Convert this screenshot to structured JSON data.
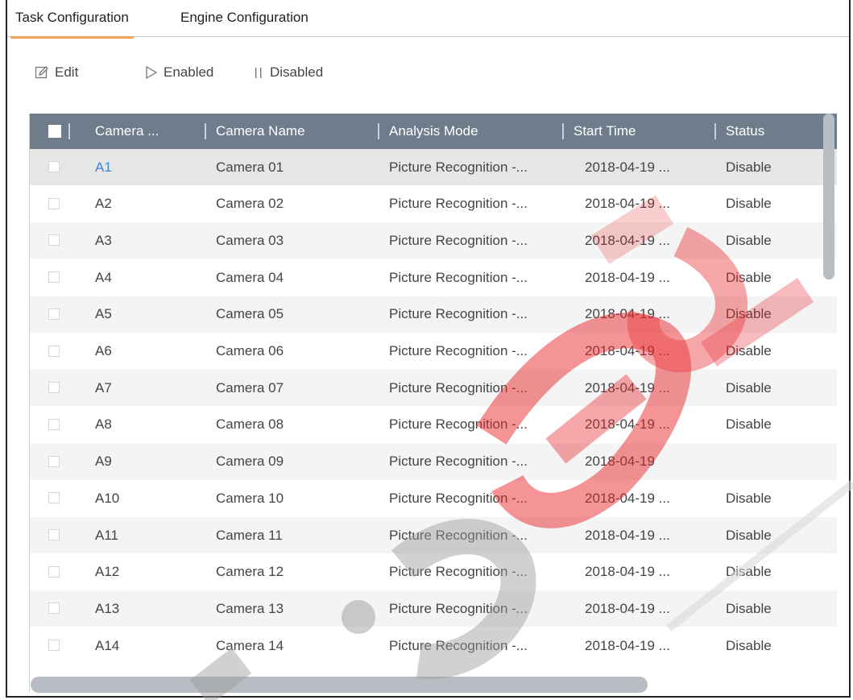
{
  "tabs": [
    {
      "label": "Task Configuration",
      "active": true
    },
    {
      "label": "Engine Configuration",
      "active": false
    }
  ],
  "toolbar": {
    "edit": "Edit",
    "enabled": "Enabled",
    "disabled": "Disabled"
  },
  "table": {
    "columns": [
      "Camera ...",
      "Camera Name",
      "Analysis Mode",
      "Start Time",
      "Status"
    ],
    "rows": [
      {
        "id": "A1",
        "name": "Camera 01",
        "mode": "Picture Recognition -...",
        "start": "2018-04-19 ...",
        "status": "Disable"
      },
      {
        "id": "A2",
        "name": "Camera 02",
        "mode": "Picture Recognition -...",
        "start": "2018-04-19 ...",
        "status": "Disable"
      },
      {
        "id": "A3",
        "name": "Camera 03",
        "mode": "Picture Recognition -...",
        "start": "2018-04-19 ...",
        "status": "Disable"
      },
      {
        "id": "A4",
        "name": "Camera 04",
        "mode": "Picture Recognition -...",
        "start": "2018-04-19 ...",
        "status": "Disable"
      },
      {
        "id": "A5",
        "name": "Camera 05",
        "mode": "Picture Recognition -...",
        "start": "2018-04-19 ...",
        "status": "Disable"
      },
      {
        "id": "A6",
        "name": "Camera 06",
        "mode": "Picture Recognition -...",
        "start": "2018-04-19 ...",
        "status": "Disable"
      },
      {
        "id": "A7",
        "name": "Camera 07",
        "mode": "Picture Recognition -...",
        "start": "2018-04-19 ...",
        "status": "Disable"
      },
      {
        "id": "A8",
        "name": "Camera 08",
        "mode": "Picture Recognition -...",
        "start": "2018-04-19 ...",
        "status": "Disable"
      },
      {
        "id": "A9",
        "name": "Camera 09",
        "mode": "Picture Recognition -...",
        "start": "2018-04-19",
        "status": ""
      },
      {
        "id": "A10",
        "name": "Camera 10",
        "mode": "Picture Recognition -...",
        "start": "2018-04-19 ...",
        "status": "Disable"
      },
      {
        "id": "A11",
        "name": "Camera 11",
        "mode": "Picture Recognition -...",
        "start": "2018-04-19 ...",
        "status": "Disable"
      },
      {
        "id": "A12",
        "name": "Camera 12",
        "mode": "Picture Recognition -...",
        "start": "2018-04-19 ...",
        "status": "Disable"
      },
      {
        "id": "A13",
        "name": "Camera 13",
        "mode": "Picture Recognition -...",
        "start": "2018-04-19 ...",
        "status": "Disable"
      },
      {
        "id": "A14",
        "name": "Camera 14",
        "mode": "Picture Recognition -...",
        "start": "2018-04-19 ...",
        "status": "Disable"
      }
    ]
  },
  "colors": {
    "header_bg": "#6e7c8b",
    "tab_accent": "#f5a357",
    "link": "#3a86d8",
    "watermark": "#e8262b"
  },
  "icons": {
    "edit": "edit-icon",
    "enabled": "play-icon",
    "disabled": "pause-icon"
  }
}
